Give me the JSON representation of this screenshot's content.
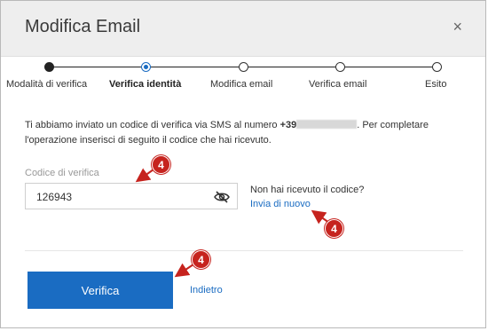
{
  "dialog": {
    "title": "Modifica Email",
    "close_label": "×"
  },
  "stepper": {
    "steps": [
      {
        "label": "Modalità di verifica",
        "state": "done"
      },
      {
        "label": "Verifica identità",
        "state": "active"
      },
      {
        "label": "Modifica email",
        "state": "pending"
      },
      {
        "label": "Verifica email",
        "state": "pending"
      },
      {
        "label": "Esito",
        "state": "pending"
      }
    ]
  },
  "info": {
    "text_before": "Ti abbiamo inviato un codice di verifica via SMS al numero ",
    "phone_prefix": "+39",
    "text_after": ". Per completare",
    "line2": "l'operazione inserisci di seguito il codice che hai ricevuto."
  },
  "code_field": {
    "label": "Codice di verifica",
    "value": "126943"
  },
  "resend": {
    "question": "Non hai ricevuto il codice?",
    "link": "Invia di nuovo"
  },
  "actions": {
    "primary": "Verifica",
    "secondary": "Indietro"
  },
  "annotations": {
    "badge_text": "4",
    "color": "#c6231e"
  },
  "colors": {
    "accent": "#1a6cc2",
    "header_bg": "#eeeeee"
  }
}
